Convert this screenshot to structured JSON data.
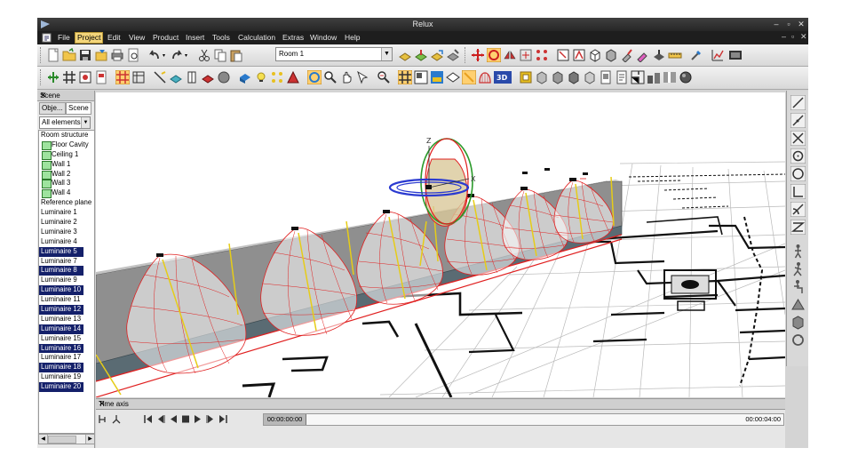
{
  "window": {
    "title": "Relux"
  },
  "window_controls": {
    "minimize": "–",
    "restore": "▫",
    "close": "✕"
  },
  "menu": [
    {
      "label": "File"
    },
    {
      "label": "Project"
    },
    {
      "label": "Edit"
    },
    {
      "label": "View"
    },
    {
      "label": "Product"
    },
    {
      "label": "Insert"
    },
    {
      "label": "Tools"
    },
    {
      "label": "Calculation"
    },
    {
      "label": "Extras"
    },
    {
      "label": "Window"
    },
    {
      "label": "Help"
    }
  ],
  "menu_selected": "Project",
  "toolbar": {
    "room_selector": {
      "value": "Room 1"
    }
  },
  "scene_panel": {
    "title": "Scene",
    "close": "✕",
    "tabs": [
      {
        "label": "Obje..."
      },
      {
        "label": "Scene"
      }
    ],
    "active_tab": "Scene",
    "filter": {
      "value": "All elements"
    },
    "items": [
      {
        "label": "Room structure",
        "indent": false,
        "selected": false,
        "icon": ""
      },
      {
        "label": "Floor Cavity",
        "indent": true,
        "selected": false,
        "icon": "wall-icon"
      },
      {
        "label": "Ceiling 1",
        "indent": true,
        "selected": false,
        "icon": "wall-icon"
      },
      {
        "label": "Wall 1",
        "indent": true,
        "selected": false,
        "icon": "wall-icon"
      },
      {
        "label": "Wall 2",
        "indent": true,
        "selected": false,
        "icon": "wall-icon"
      },
      {
        "label": "Wall 3",
        "indent": true,
        "selected": false,
        "icon": "wall-icon"
      },
      {
        "label": "Wall 4",
        "indent": true,
        "selected": false,
        "icon": "wall-icon"
      },
      {
        "label": "Reference plane",
        "indent": false,
        "selected": false,
        "icon": ""
      },
      {
        "label": "Luminaire 1",
        "indent": false,
        "selected": false,
        "icon": ""
      },
      {
        "label": "Luminaire 2",
        "indent": false,
        "selected": false,
        "icon": ""
      },
      {
        "label": "Luminaire 3",
        "indent": false,
        "selected": false,
        "icon": ""
      },
      {
        "label": "Luminaire 4",
        "indent": false,
        "selected": false,
        "icon": ""
      },
      {
        "label": "Luminaire 5",
        "indent": false,
        "selected": true,
        "icon": ""
      },
      {
        "label": "Luminaire 7",
        "indent": false,
        "selected": false,
        "icon": ""
      },
      {
        "label": "Luminaire 8",
        "indent": false,
        "selected": true,
        "icon": ""
      },
      {
        "label": "Luminaire 9",
        "indent": false,
        "selected": false,
        "icon": ""
      },
      {
        "label": "Luminaire 10",
        "indent": false,
        "selected": true,
        "icon": ""
      },
      {
        "label": "Luminaire 11",
        "indent": false,
        "selected": false,
        "icon": ""
      },
      {
        "label": "Luminaire 12",
        "indent": false,
        "selected": true,
        "icon": ""
      },
      {
        "label": "Luminaire 13",
        "indent": false,
        "selected": false,
        "icon": ""
      },
      {
        "label": "Luminaire 14",
        "indent": false,
        "selected": true,
        "icon": ""
      },
      {
        "label": "Luminaire 15",
        "indent": false,
        "selected": false,
        "icon": ""
      },
      {
        "label": "Luminaire 16",
        "indent": false,
        "selected": true,
        "icon": ""
      },
      {
        "label": "Luminaire 17",
        "indent": false,
        "selected": false,
        "icon": ""
      },
      {
        "label": "Luminaire 18",
        "indent": false,
        "selected": true,
        "icon": ""
      },
      {
        "label": "Luminaire 19",
        "indent": false,
        "selected": false,
        "icon": ""
      },
      {
        "label": "Luminaire 20",
        "indent": false,
        "selected": true,
        "icon": ""
      }
    ]
  },
  "viewport": {
    "axis_labels": {
      "z": "Z",
      "x": "X"
    }
  },
  "time_axis": {
    "title": "Time axis",
    "close": "✕",
    "current_time": "00:00:00:00",
    "end_time": "00:00:04:00"
  },
  "colors": {
    "titlebar": "#2e2e2e",
    "menubar": "#1e1e1e",
    "menu_highlight": "#f3d57a",
    "selection": "#14206a",
    "light_distribution": "#e02020",
    "light_ray": "#e8d020",
    "wall": "#9a9a9a",
    "floor_strip": "#5c6e76"
  }
}
